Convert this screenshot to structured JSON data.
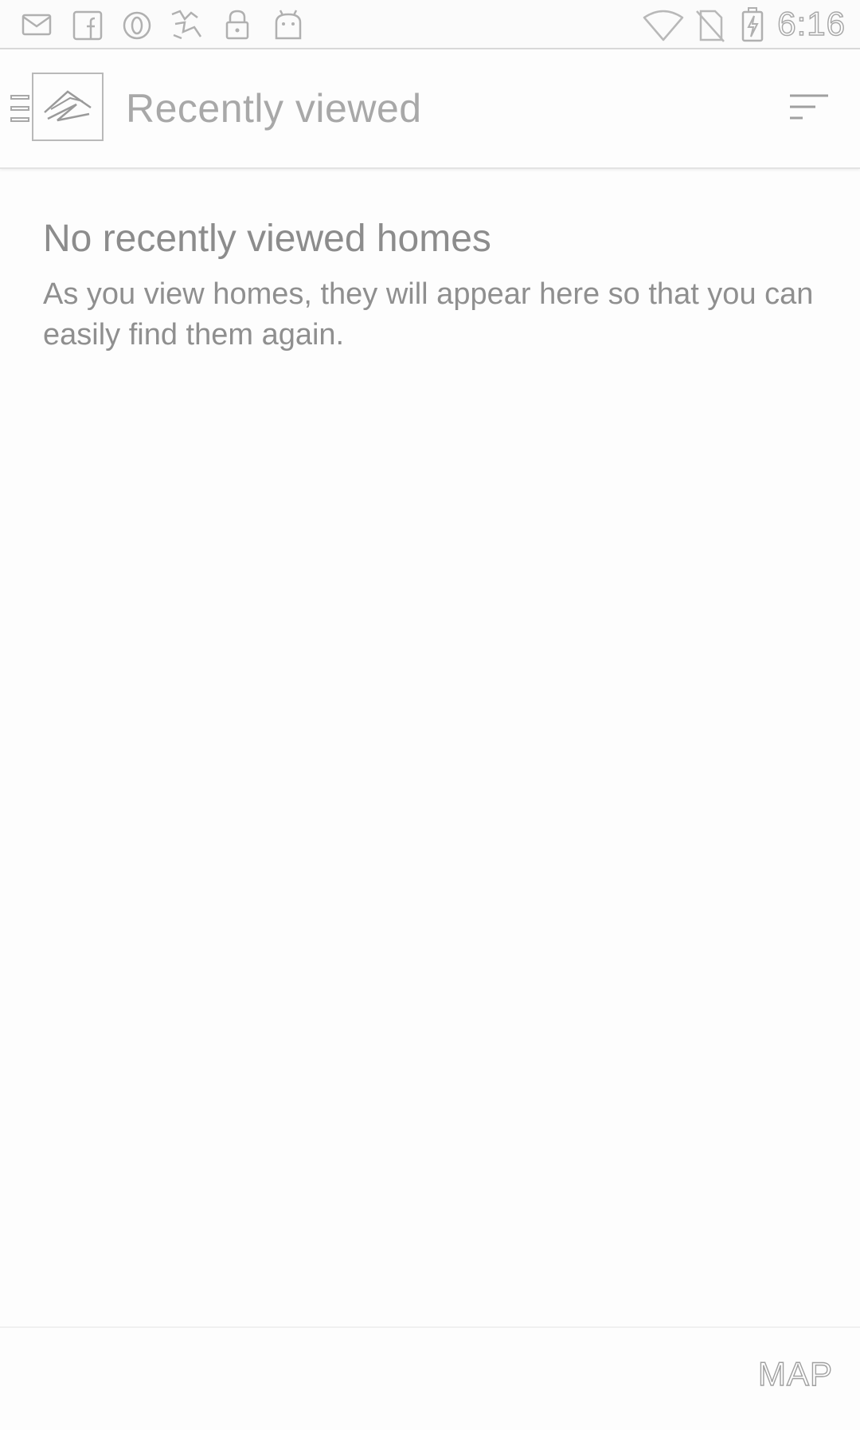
{
  "status_bar": {
    "time": "6:16",
    "left_icons": [
      "mail-icon",
      "facebook-icon",
      "opera-icon",
      "app-shortcut-icon",
      "lock-icon",
      "android-icon"
    ],
    "right_icons": [
      "wifi-icon",
      "no-sim-icon",
      "battery-charging-icon"
    ]
  },
  "app_bar": {
    "title": "Recently viewed",
    "menu_icon": "hamburger-menu-icon",
    "logo_icon": "zillow-logo-icon",
    "sort_icon": "sort-icon"
  },
  "empty_state": {
    "title": "No recently viewed homes",
    "message": "As you view homes, they will appear here so that you can easily find them again."
  },
  "bottom_bar": {
    "map_label": "MAP"
  },
  "colors": {
    "background": "#fdfdfd",
    "text": "#8c8c8c",
    "divider": "#e3e3e3"
  }
}
